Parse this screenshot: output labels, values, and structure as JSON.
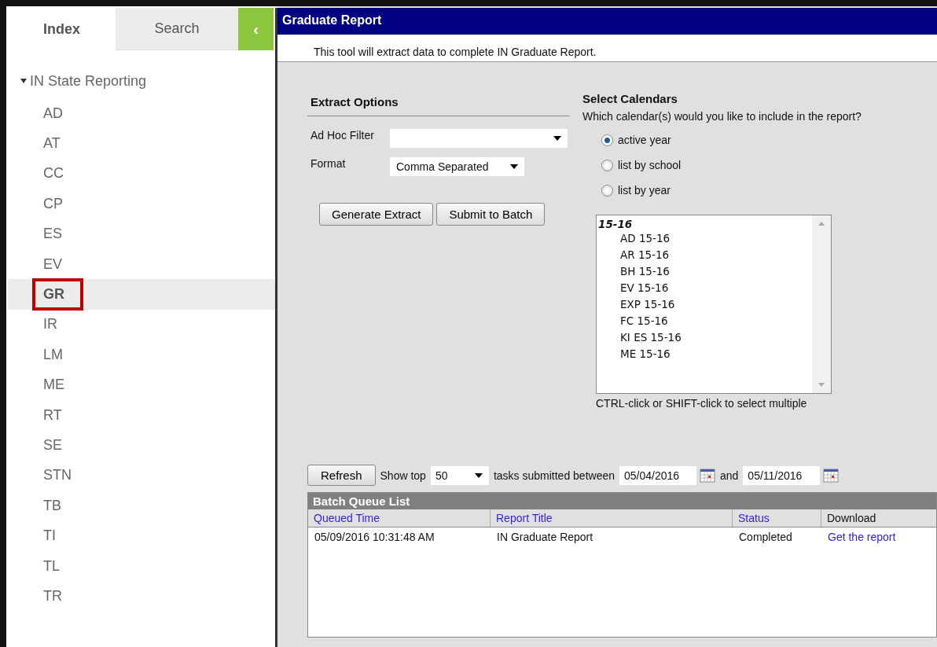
{
  "sidebar": {
    "tabs": [
      {
        "label": "Index",
        "selected": true
      },
      {
        "label": "Search",
        "selected": false
      }
    ],
    "collapse_button": "‹",
    "items": [
      {
        "label": "IN State Reporting",
        "expanded": true,
        "children": [
          {
            "label": "AD",
            "selected": false,
            "annotated": false
          },
          {
            "label": "AT",
            "selected": false,
            "annotated": false
          },
          {
            "label": "CC",
            "selected": false,
            "annotated": false
          },
          {
            "label": "CP",
            "selected": false,
            "annotated": false
          },
          {
            "label": "ES",
            "selected": false,
            "annotated": false
          },
          {
            "label": "EV",
            "selected": false,
            "annotated": false
          },
          {
            "label": "GR",
            "selected": true,
            "annotated": true
          },
          {
            "label": "IR",
            "selected": false,
            "annotated": false
          },
          {
            "label": "LM",
            "selected": false,
            "annotated": false
          },
          {
            "label": "ME",
            "selected": false,
            "annotated": false
          },
          {
            "label": "RT",
            "selected": false,
            "annotated": false
          },
          {
            "label": "SE",
            "selected": false,
            "annotated": false
          },
          {
            "label": "STN",
            "selected": false,
            "annotated": false
          },
          {
            "label": "TB",
            "selected": false,
            "annotated": false
          },
          {
            "label": "TI",
            "selected": false,
            "annotated": false
          },
          {
            "label": "TL",
            "selected": false,
            "annotated": false
          },
          {
            "label": "TR",
            "selected": false,
            "annotated": false
          }
        ]
      }
    ]
  },
  "window": {
    "title": "Graduate Report",
    "description": "This tool will extract data to complete IN Graduate Report."
  },
  "extract_options": {
    "heading": "Extract Options",
    "fields": [
      {
        "label": "Ad Hoc Filter"
      },
      {
        "label": "Format",
        "value": "Comma Separated"
      }
    ],
    "buttons": [
      "Generate Extract",
      "Submit to Batch"
    ]
  },
  "calendars": {
    "heading": "Select Calendars",
    "question": "Which calendar(s) would you like to include in the report?",
    "options": [
      {
        "label": "active year",
        "selected": true
      },
      {
        "label": "list by school",
        "selected": false
      },
      {
        "label": "list by year",
        "selected": false
      }
    ],
    "list": {
      "group": "15-16",
      "items": [
        "AD 15-16",
        "AR 15-16",
        "BH 15-16",
        "EV 15-16",
        "EXP 15-16",
        "FC 15-16",
        "KI ES 15-16",
        "ME 15-16"
      ]
    },
    "hint": "CTRL-click or SHIFT-click to select multiple"
  },
  "batch": {
    "refresh_button": "Refresh",
    "show_top_label": "Show top",
    "show_top_value": "50",
    "between_label": "tasks submitted between",
    "start_date": "05/04/2016",
    "and_label": "and",
    "end_date": "05/11/2016",
    "title": "Batch Queue List",
    "columns": [
      {
        "label": "Queued Time",
        "sortable": true
      },
      {
        "label": "Report Title",
        "sortable": true
      },
      {
        "label": "Status",
        "sortable": true
      },
      {
        "label": "Download",
        "sortable": false
      }
    ],
    "rows": [
      {
        "cells": [
          {
            "text": "05/09/2016 10:31:48 AM",
            "kind": "text"
          },
          {
            "text": "IN Graduate Report",
            "kind": "text"
          },
          {
            "text": "Completed",
            "kind": "text"
          },
          {
            "text": "Get the report",
            "kind": "link"
          }
        ]
      }
    ]
  }
}
